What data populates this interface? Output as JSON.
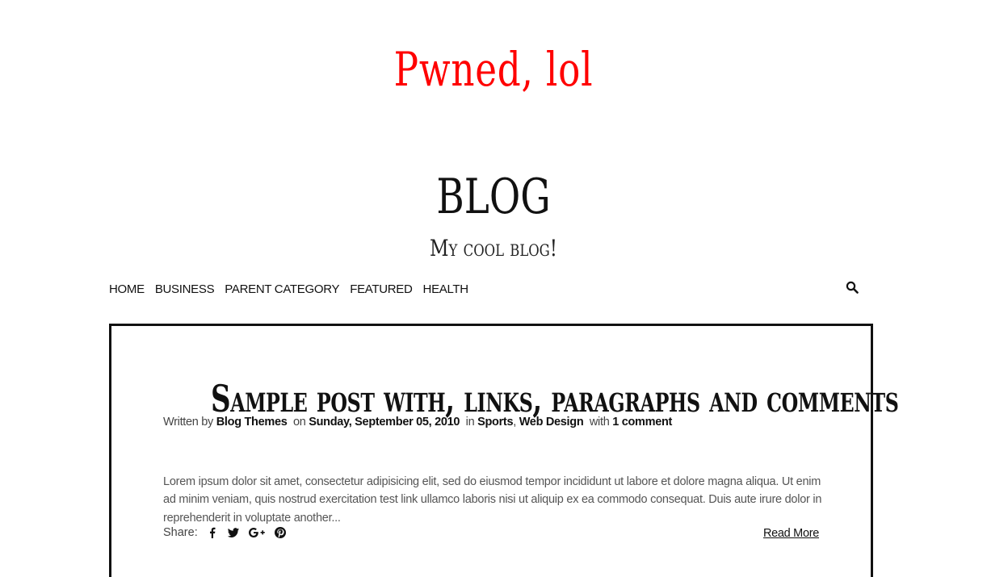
{
  "banner": {
    "text": "Pwned, lol",
    "color": "#ff0000"
  },
  "site": {
    "title": "BLOG",
    "tagline": "My cool blog!"
  },
  "nav": {
    "items": [
      {
        "label": "HOME"
      },
      {
        "label": "BUSINESS"
      },
      {
        "label": "PARENT CATEGORY"
      },
      {
        "label": "FEATURED"
      },
      {
        "label": "HEALTH"
      }
    ],
    "search_icon": "search-icon"
  },
  "post": {
    "title": "Sample post with, links, paragraphs and comments",
    "meta": {
      "written_by_prefix": "Written by",
      "author": "Blog Themes",
      "on_prefix": "on",
      "date": "Sunday, September 05, 2010",
      "in_prefix": "in",
      "categories": [
        "Sports",
        "Web Design"
      ],
      "category_separator": ",",
      "with_prefix": "with",
      "comments": "1 comment"
    },
    "excerpt": "Lorem ipsum dolor sit amet, consectetur adipisicing elit, sed do eiusmod tempor incididunt ut labore et dolore magna aliqua. Ut enim ad minim veniam, quis nostrud exercitation test link ullamco laboris nisi ut aliquip ex ea commodo consequat. Duis aute irure dolor in reprehenderit in voluptate another...",
    "share_label": "Share:",
    "share_icons": [
      "facebook-icon",
      "twitter-icon",
      "google-plus-icon",
      "pinterest-icon"
    ],
    "read_more": "Read More"
  }
}
